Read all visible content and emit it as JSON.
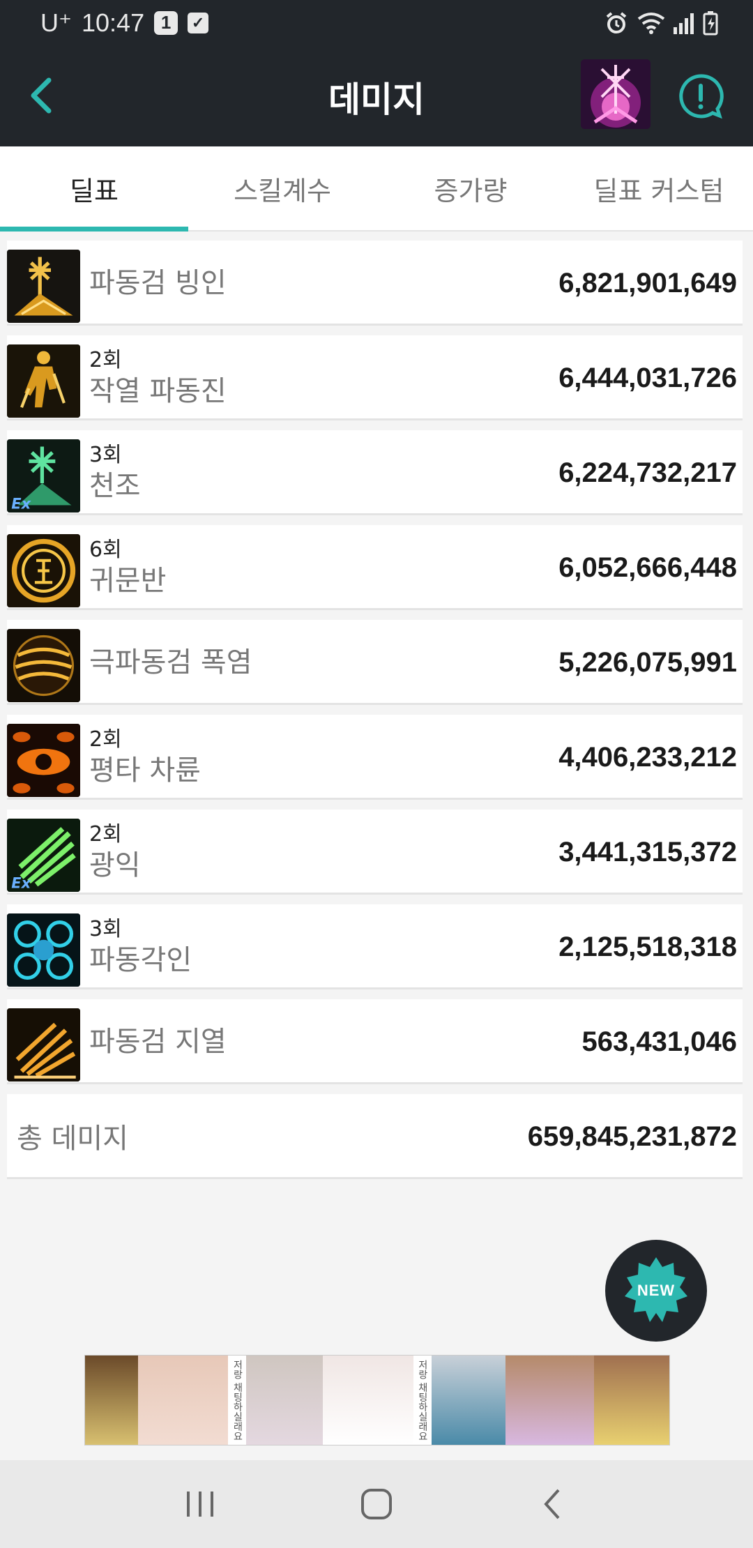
{
  "status_bar": {
    "carrier": "U⁺",
    "time": "10:47",
    "notification_count": "1"
  },
  "header": {
    "title": "데미지",
    "back_icon": "chevron-left-icon",
    "info_icon": "exclamation-circle-icon",
    "accent_color": "#2db8b0"
  },
  "tabs": [
    {
      "label": "딜표",
      "active": true
    },
    {
      "label": "스킬계수",
      "active": false
    },
    {
      "label": "증가량",
      "active": false
    },
    {
      "label": "딜표 커스텀",
      "active": false
    }
  ],
  "skills": [
    {
      "hits": "",
      "name": "파동검 빙인",
      "damage": "6,821,901,649",
      "icon": "ice-sword-skill-icon"
    },
    {
      "hits": "2회",
      "name": "작열 파동진",
      "damage": "6,444,031,726",
      "icon": "fire-figure-skill-icon"
    },
    {
      "hits": "3회",
      "name": "천조",
      "damage": "6,224,732,217",
      "icon": "green-star-skill-icon"
    },
    {
      "hits": "6회",
      "name": "귀문반",
      "damage": "6,052,666,448",
      "icon": "rune-circle-skill-icon"
    },
    {
      "hits": "",
      "name": "극파동검 폭염",
      "damage": "5,226,075,991",
      "icon": "flame-sphere-skill-icon"
    },
    {
      "hits": "2회",
      "name": "평타 차륜",
      "damage": "4,406,233,212",
      "icon": "eye-skill-icon"
    },
    {
      "hits": "2회",
      "name": "광익",
      "damage": "3,441,315,372",
      "icon": "green-wing-skill-icon"
    },
    {
      "hits": "3회",
      "name": "파동각인",
      "damage": "2,125,518,318",
      "icon": "blue-seal-skill-icon"
    },
    {
      "hits": "",
      "name": "파동검 지열",
      "damage": "563,431,046",
      "icon": "ground-slash-skill-icon"
    }
  ],
  "total": {
    "label": "총 데미지",
    "damage": "659,845,231,872"
  },
  "fab": {
    "label": "NEW"
  },
  "ad": {
    "vertical_text_1": "저랑 채팅하실래요",
    "vertical_text_2": "저랑 채팅하실래요"
  }
}
